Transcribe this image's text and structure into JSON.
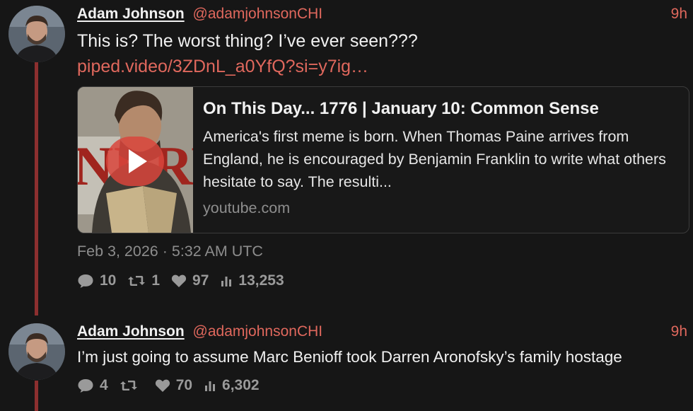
{
  "colors": {
    "background": "#161616",
    "accent": "#e0685d",
    "thread_line": "#8c2f2f",
    "muted": "#8d8d8d"
  },
  "tweets": [
    {
      "fullname": "Adam Johnson",
      "handle": "@adamjohnsonCHI",
      "time": "9h",
      "text": "This is? The worst thing? I’ve ever seen???",
      "link": "piped.video/3ZDnL_a0YfQ?si=y7ig…",
      "card": {
        "title": "On This Day... 1776 | January 10: Common Sense",
        "description": "America's first meme is born. When Thomas Paine arrives from England, he is encouraged by Benjamin Franklin to write what others hesitate to say. The resulti...",
        "domain": "youtube.com",
        "thumbnail_icon": "play-icon"
      },
      "date": "Feb 3, 2026 · 5:32 AM UTC",
      "stats": {
        "replies": "10",
        "retweets": "1",
        "likes": "97",
        "views": "13,253"
      }
    },
    {
      "fullname": "Adam Johnson",
      "handle": "@adamjohnsonCHI",
      "time": "9h",
      "text": "I’m just going to assume Marc Benioff took Darren Aronofsky’s family hostage",
      "stats": {
        "replies": "4",
        "retweets": "",
        "likes": "70",
        "views": "6,302"
      }
    }
  ],
  "icons": [
    "comment-icon",
    "retweet-icon",
    "heart-icon",
    "views-icon"
  ]
}
